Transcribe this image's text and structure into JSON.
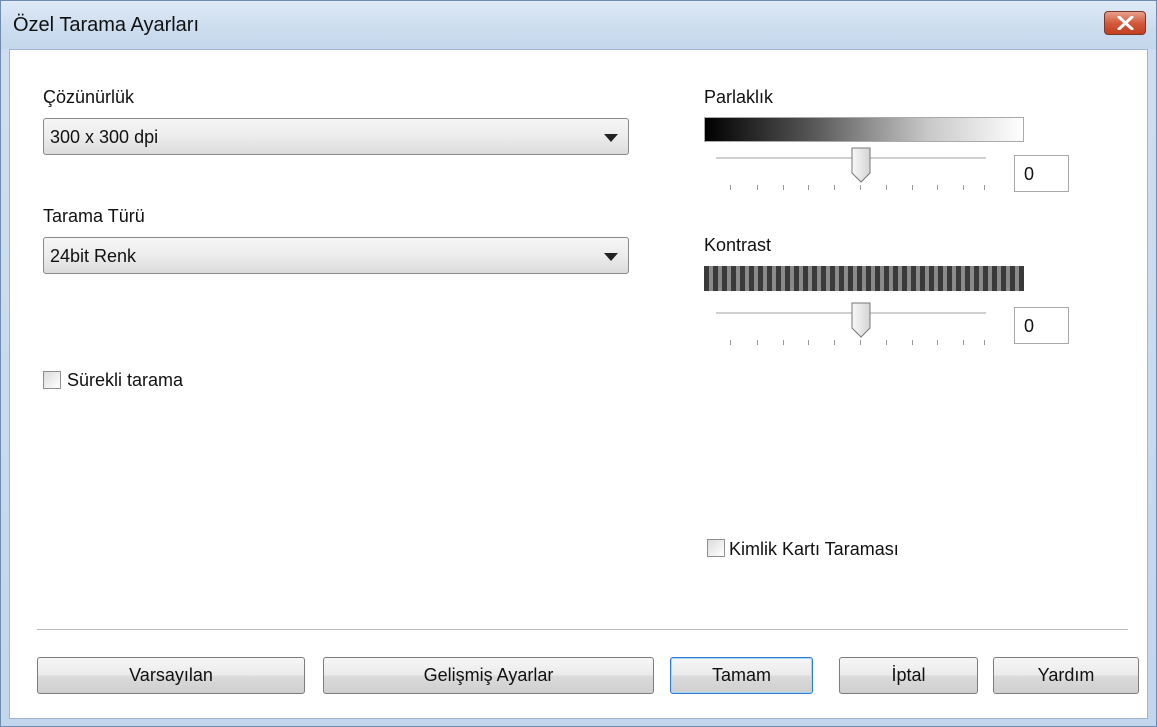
{
  "window": {
    "title": "Özel Tarama Ayarları"
  },
  "resolution": {
    "label": "Çözünürlük",
    "value": "300 x 300 dpi"
  },
  "scan_type": {
    "label": "Tarama Türü",
    "value": "24bit Renk"
  },
  "continuous_scan": {
    "label": "Sürekli tarama",
    "checked": false
  },
  "brightness": {
    "label": "Parlaklık",
    "value": "0"
  },
  "contrast": {
    "label": "Kontrast",
    "value": "0"
  },
  "id_card_scan": {
    "label": "Kimlik Kartı Taraması",
    "checked": false
  },
  "buttons": {
    "default": "Varsayılan",
    "advanced": "Gelişmiş Ayarlar",
    "ok": "Tamam",
    "cancel": "İptal",
    "help": "Yardım"
  }
}
